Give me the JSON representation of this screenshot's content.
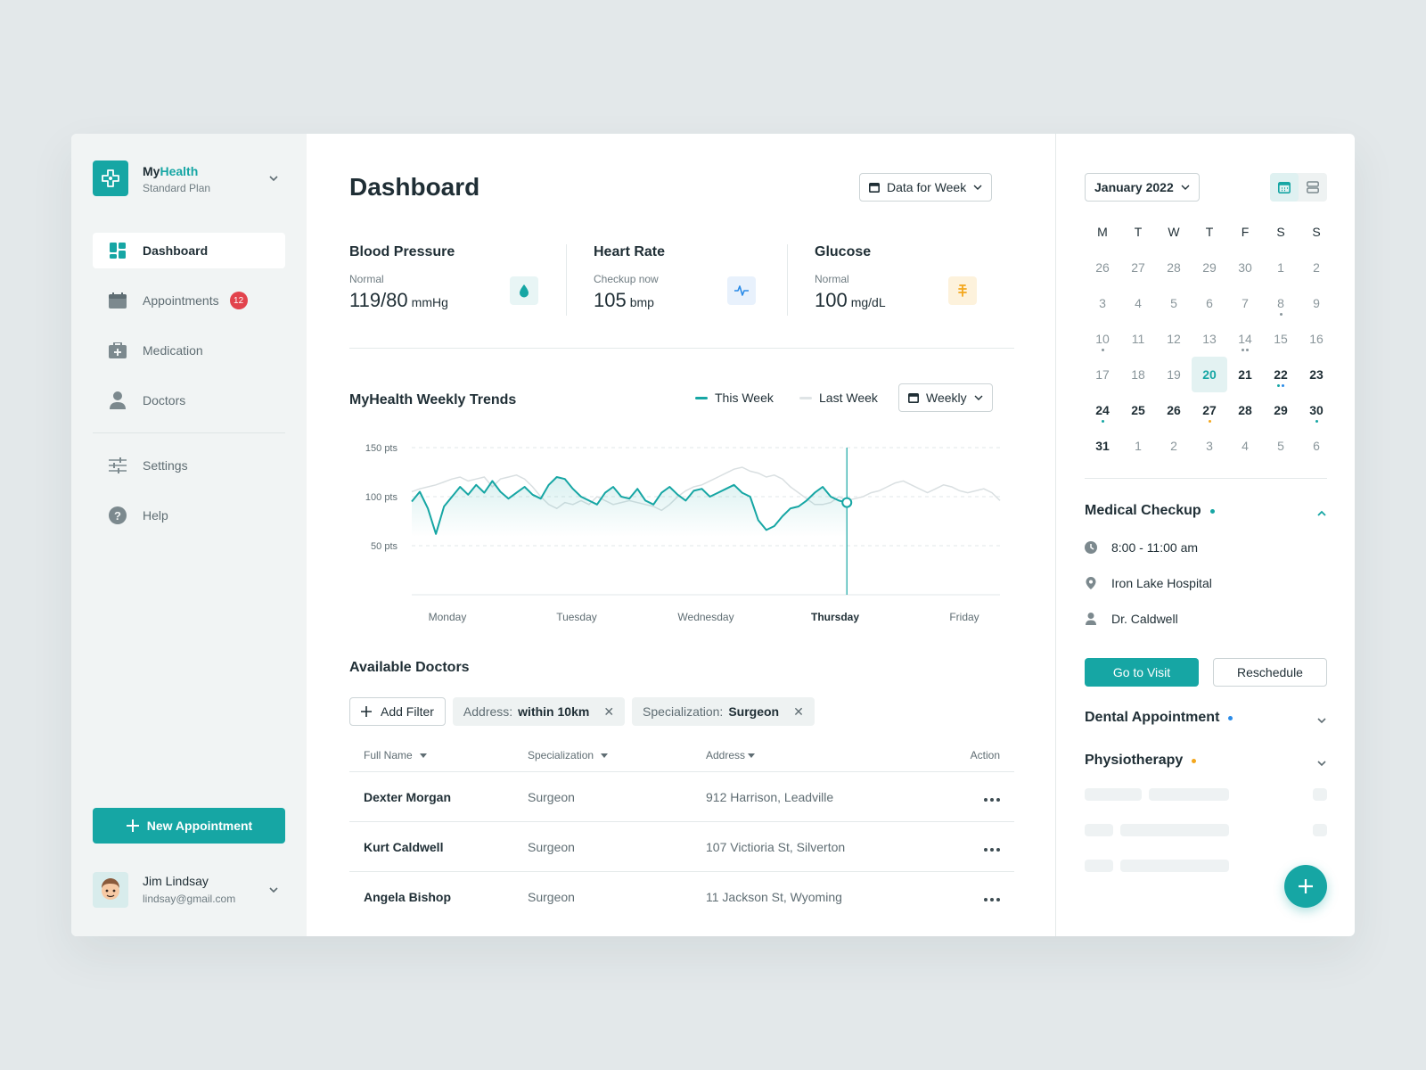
{
  "brand": {
    "name_prefix": "My",
    "name_accent": "Health",
    "plan": "Standard Plan"
  },
  "sidebar": {
    "items": [
      {
        "label": "Dashboard",
        "icon": "dashboard-icon",
        "active": true
      },
      {
        "label": "Appointments",
        "icon": "calendar-icon",
        "badge": "12"
      },
      {
        "label": "Medication",
        "icon": "medkit-icon"
      },
      {
        "label": "Doctors",
        "icon": "person-icon"
      },
      {
        "label": "Settings",
        "icon": "sliders-icon"
      },
      {
        "label": "Help",
        "icon": "help-icon"
      }
    ],
    "new_appointment": "New Appointment"
  },
  "user": {
    "name": "Jim Lindsay",
    "email": "lindsay@gmail.com"
  },
  "header": {
    "title": "Dashboard",
    "period_button": "Data for Week"
  },
  "metrics": [
    {
      "title": "Blood Pressure",
      "sub": "Normal",
      "value": "119/80",
      "unit": "mmHg",
      "icon": "drop-icon",
      "color": "#16a6a4"
    },
    {
      "title": "Heart Rate",
      "sub": "Checkup now",
      "value": "105",
      "unit": "bmp",
      "icon": "pulse-icon",
      "color": "#2a8be8"
    },
    {
      "title": "Glucose",
      "sub": "Normal",
      "value": "100",
      "unit": "mg/dL",
      "icon": "glucose-icon",
      "color": "#f3a71d"
    }
  ],
  "trends": {
    "title": "MyHealth Weekly Trends",
    "legend_this": "This Week",
    "legend_last": "Last Week",
    "range_button": "Weekly"
  },
  "chart_data": {
    "type": "line",
    "x": [
      "Monday",
      "Tuesday",
      "Wednesday",
      "Thursday",
      "Friday"
    ],
    "y_ticks": [
      "150 pts",
      "100 pts",
      "50 pts"
    ],
    "ylim": [
      0,
      150
    ],
    "highlight_x": "Thursday",
    "series": [
      {
        "name": "This Week",
        "color": "#16a6a4",
        "values": [
          95,
          105,
          88,
          62,
          90,
          100,
          110,
          102,
          112,
          104,
          116,
          105,
          98,
          104,
          110,
          102,
          98,
          112,
          120,
          118,
          108,
          100,
          96,
          92,
          104,
          110,
          100,
          98,
          108,
          96,
          92,
          104,
          110,
          102,
          96,
          106,
          108,
          100,
          104,
          108,
          112,
          104,
          100,
          76,
          66,
          70,
          80,
          88,
          90,
          96,
          104,
          110,
          100,
          96,
          94,
          102,
          110,
          108,
          116,
          114,
          124,
          122,
          118,
          120,
          112,
          110,
          108,
          114,
          116,
          112,
          110,
          106,
          102,
          100
        ]
      },
      {
        "name": "Last Week",
        "color": "#d9dfe1",
        "values": [
          105,
          108,
          110,
          112,
          115,
          118,
          120,
          116,
          118,
          120,
          110,
          118,
          120,
          122,
          118,
          110,
          100,
          92,
          88,
          94,
          92,
          96,
          92,
          100,
          96,
          92,
          94,
          96,
          94,
          92,
          90,
          86,
          92,
          100,
          106,
          110,
          112,
          116,
          120,
          124,
          128,
          130,
          126,
          124,
          120,
          122,
          118,
          110,
          104,
          98,
          92,
          92,
          94,
          100,
          96,
          98,
          100,
          104,
          106,
          110,
          114,
          116,
          112,
          108,
          104,
          108,
          112,
          110,
          106,
          104,
          106,
          108,
          104,
          96
        ]
      }
    ]
  },
  "doctors": {
    "title": "Available Doctors",
    "add_filter": "Add Filter",
    "filters": [
      {
        "key": "Address:",
        "value": "within 10km"
      },
      {
        "key": "Specialization:",
        "value": "Surgeon"
      }
    ],
    "columns": [
      "Full Name",
      "Specialization",
      "Address",
      "Action"
    ],
    "rows": [
      {
        "name": "Dexter Morgan",
        "spec": "Surgeon",
        "address": "912 Harrison, Leadville"
      },
      {
        "name": "Kurt Caldwell",
        "spec": "Surgeon",
        "address": "107 Victioria St, Silverton"
      },
      {
        "name": "Angela Bishop",
        "spec": "Surgeon",
        "address": "11 Jackson St, Wyoming"
      }
    ]
  },
  "calendar": {
    "month": "January 2022",
    "weekdays": [
      "M",
      "T",
      "W",
      "T",
      "F",
      "S",
      "S"
    ],
    "weeks": [
      [
        {
          "d": "26",
          "m": "o"
        },
        {
          "d": "27",
          "m": "o"
        },
        {
          "d": "28",
          "m": "o"
        },
        {
          "d": "29",
          "m": "o"
        },
        {
          "d": "30",
          "m": "o"
        },
        {
          "d": "1",
          "m": "p"
        },
        {
          "d": "2",
          "m": "p"
        }
      ],
      [
        {
          "d": "3",
          "m": "p"
        },
        {
          "d": "4",
          "m": "p"
        },
        {
          "d": "5",
          "m": "p"
        },
        {
          "d": "6",
          "m": "p"
        },
        {
          "d": "7",
          "m": "p"
        },
        {
          "d": "8",
          "m": "p",
          "dots": [
            "#8a969b"
          ]
        },
        {
          "d": "9",
          "m": "p"
        }
      ],
      [
        {
          "d": "10",
          "m": "p",
          "dots": [
            "#8a969b"
          ]
        },
        {
          "d": "11",
          "m": "p"
        },
        {
          "d": "12",
          "m": "p"
        },
        {
          "d": "13",
          "m": "p"
        },
        {
          "d": "14",
          "m": "p",
          "dots": [
            "#8a969b",
            "#8a969b"
          ]
        },
        {
          "d": "15",
          "m": "p"
        },
        {
          "d": "16",
          "m": "p"
        }
      ],
      [
        {
          "d": "17",
          "m": "p"
        },
        {
          "d": "18",
          "m": "p"
        },
        {
          "d": "19",
          "m": "p"
        },
        {
          "d": "20",
          "m": "t"
        },
        {
          "d": "21",
          "m": "f"
        },
        {
          "d": "22",
          "m": "f",
          "dots": [
            "#16a6a4",
            "#2a8be8"
          ]
        },
        {
          "d": "23",
          "m": "f"
        }
      ],
      [
        {
          "d": "24",
          "m": "f",
          "dots": [
            "#16a6a4"
          ]
        },
        {
          "d": "25",
          "m": "f"
        },
        {
          "d": "26",
          "m": "f"
        },
        {
          "d": "27",
          "m": "f",
          "dots": [
            "#f3a71d"
          ]
        },
        {
          "d": "28",
          "m": "f"
        },
        {
          "d": "29",
          "m": "f"
        },
        {
          "d": "30",
          "m": "f",
          "dots": [
            "#16a6a4"
          ]
        }
      ],
      [
        {
          "d": "31",
          "m": "f"
        },
        {
          "d": "1",
          "m": "o"
        },
        {
          "d": "2",
          "m": "o"
        },
        {
          "d": "3",
          "m": "o"
        },
        {
          "d": "4",
          "m": "o"
        },
        {
          "d": "5",
          "m": "o"
        },
        {
          "d": "6",
          "m": "o"
        }
      ]
    ]
  },
  "events": {
    "checkup": {
      "title": "Medical Checkup",
      "dot": "#16a6a4",
      "time": "8:00 - 11:00 am",
      "place": "Iron Lake Hospital",
      "doctor": "Dr. Caldwell",
      "go": "Go to Visit",
      "reschedule": "Reschedule"
    },
    "dental": {
      "title": "Dental Appointment",
      "dot": "#2a8be8"
    },
    "physio": {
      "title": "Physiotherapy",
      "dot": "#f3a71d"
    }
  }
}
